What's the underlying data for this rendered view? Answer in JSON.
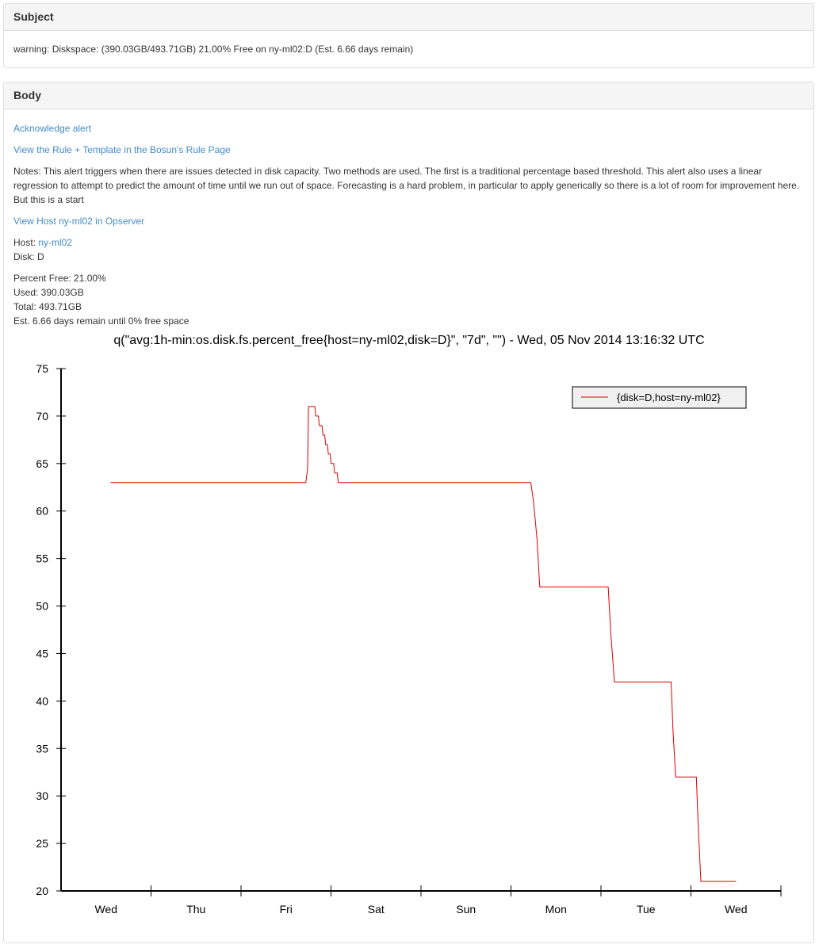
{
  "subject": {
    "heading": "Subject",
    "text": "warning: Diskspace: (390.03GB/493.71GB) 21.00% Free on ny-ml02:D (Est. 6.66 days remain)"
  },
  "body": {
    "heading": "Body",
    "acknowledge_link": "Acknowledge alert",
    "rule_link": "View the Rule + Template in the Bosun's Rule Page",
    "notes": "Notes: This alert triggers when there are issues detected in disk capacity. Two methods are used. The first is a traditional percentage based threshold. This alert also uses a linear regression to attempt to predict the amount of time until we run out of space. Forecasting is a hard problem, in particular to apply generically so there is a lot of room for improvement here. But this is a start",
    "opserver_link": "View Host ny-ml02 in Opserver",
    "host_label": "Host: ",
    "host_value": "ny-ml02",
    "disk_line": "Disk: D",
    "percent_free_line": "Percent Free: 21.00%",
    "used_line": "Used: 390.03GB",
    "total_line": "Total: 493.71GB",
    "est_line": "Est. 6.66 days remain until 0% free space"
  },
  "chart_data": {
    "type": "line",
    "title": "q(\"avg:1h-min:os.disk.fs.percent_free{host=ny-ml02,disk=D}\", \"7d\", \"\") - Wed, 05 Nov 2014 13:16:32 UTC",
    "xlabel": "",
    "ylabel": "",
    "x_tick_labels": [
      "Wed",
      "Thu",
      "Fri",
      "Sat",
      "Sun",
      "Mon",
      "Tue",
      "Wed"
    ],
    "xlim_days": [
      0,
      7.5
    ],
    "ylim": [
      20,
      75
    ],
    "y_ticks": [
      20,
      25,
      30,
      35,
      40,
      45,
      50,
      55,
      60,
      65,
      70,
      75
    ],
    "legend_position": "top-right",
    "line_color": "#dd0000",
    "series": [
      {
        "name": "{disk=D,host=ny-ml02}",
        "points": [
          [
            0.55,
            63
          ],
          [
            2.72,
            63
          ],
          [
            2.74,
            64.5
          ],
          [
            2.75,
            71
          ],
          [
            2.82,
            71
          ],
          [
            2.83,
            70
          ],
          [
            2.86,
            70
          ],
          [
            2.87,
            69
          ],
          [
            2.9,
            69
          ],
          [
            2.91,
            68
          ],
          [
            2.93,
            68
          ],
          [
            2.94,
            67
          ],
          [
            2.96,
            67
          ],
          [
            2.97,
            66
          ],
          [
            2.99,
            66
          ],
          [
            3.0,
            65
          ],
          [
            3.03,
            65
          ],
          [
            3.04,
            64
          ],
          [
            3.07,
            64
          ],
          [
            3.08,
            63
          ],
          [
            5.22,
            63
          ],
          [
            5.25,
            61
          ],
          [
            5.29,
            57
          ],
          [
            5.32,
            52
          ],
          [
            6.08,
            52
          ],
          [
            6.11,
            47
          ],
          [
            6.15,
            42
          ],
          [
            6.78,
            42
          ],
          [
            6.8,
            37
          ],
          [
            6.83,
            32
          ],
          [
            7.06,
            32
          ],
          [
            7.08,
            27
          ],
          [
            7.11,
            21
          ],
          [
            7.5,
            21
          ]
        ]
      }
    ]
  }
}
